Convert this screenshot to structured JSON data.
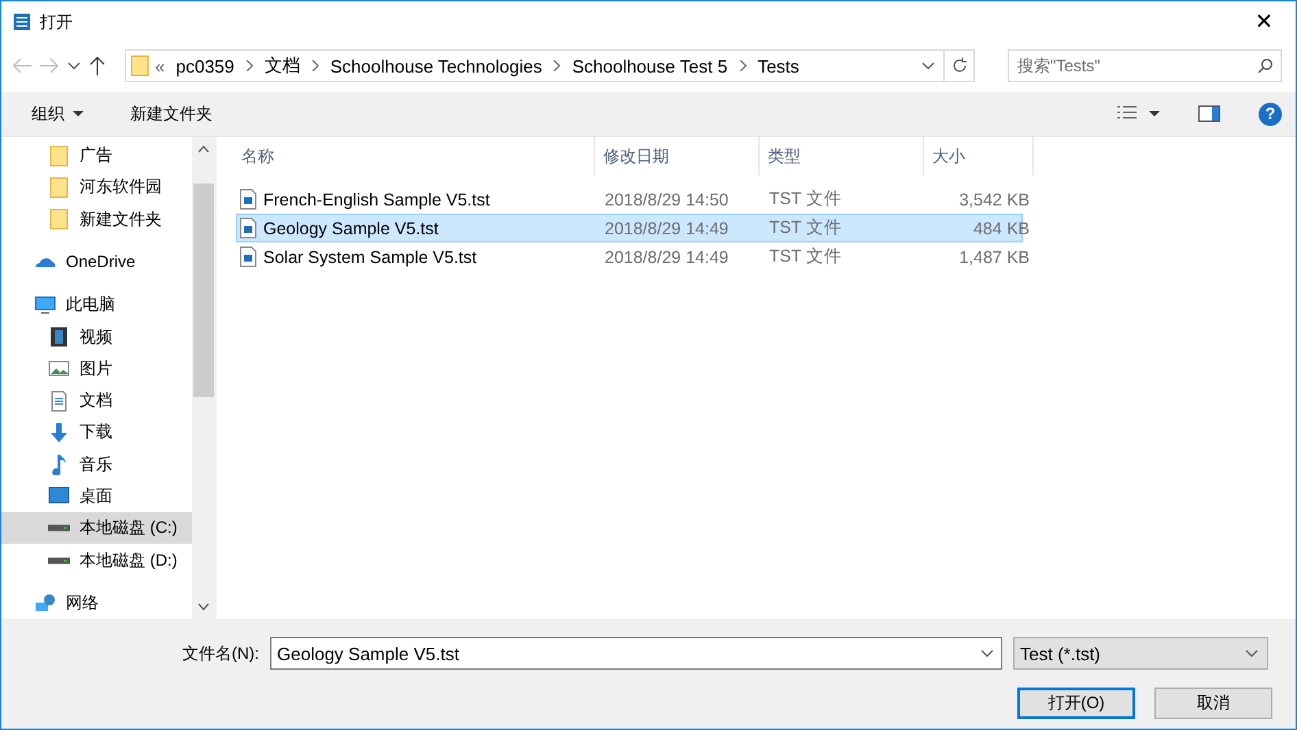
{
  "window": {
    "title": "打开",
    "close": "✕"
  },
  "address": {
    "overflow": "«",
    "crumbs": [
      "pc0359",
      "文档",
      "Schoolhouse Technologies",
      "Schoolhouse Test 5",
      "Tests"
    ]
  },
  "search": {
    "placeholder": "搜索\"Tests\""
  },
  "toolbar": {
    "organize": "组织",
    "new_folder": "新建文件夹",
    "help": "?"
  },
  "sidebar": {
    "items": [
      {
        "kind": "folder",
        "label": "广告",
        "selected": false
      },
      {
        "kind": "folder",
        "label": "河东软件园",
        "selected": false
      },
      {
        "kind": "folder",
        "label": "新建文件夹",
        "selected": false
      },
      {
        "kind": "cloud",
        "label": "OneDrive",
        "selected": false
      },
      {
        "kind": "computer",
        "label": "此电脑",
        "selected": false,
        "children": [
          {
            "kind": "video",
            "label": "视频",
            "selected": false
          },
          {
            "kind": "pictures",
            "label": "图片",
            "selected": false
          },
          {
            "kind": "documents",
            "label": "文档",
            "selected": false
          },
          {
            "kind": "downloads",
            "label": "下载",
            "selected": false
          },
          {
            "kind": "music",
            "label": "音乐",
            "selected": false
          },
          {
            "kind": "desktop",
            "label": "桌面",
            "selected": false
          },
          {
            "kind": "drive",
            "label": "本地磁盘 (C:)",
            "selected": true
          },
          {
            "kind": "drive",
            "label": "本地磁盘 (D:)",
            "selected": false
          }
        ]
      },
      {
        "kind": "network",
        "label": "网络",
        "selected": false
      }
    ]
  },
  "table": {
    "columns": [
      "名称",
      "修改日期",
      "类型",
      "大小"
    ],
    "rows": [
      {
        "name": "French-English Sample V5.tst",
        "modified": "2018/8/29 14:50",
        "type": "TST 文件",
        "size": "3,542 KB",
        "selected": false
      },
      {
        "name": "Geology Sample V5.tst",
        "modified": "2018/8/29 14:49",
        "type": "TST 文件",
        "size": "484 KB",
        "selected": true
      },
      {
        "name": "Solar System Sample V5.tst",
        "modified": "2018/8/29 14:49",
        "type": "TST 文件",
        "size": "1,487 KB",
        "selected": false
      }
    ]
  },
  "footer": {
    "filename_label": "文件名(N):",
    "filename": "Geology Sample V5.tst",
    "filter": "Test (*.tst)",
    "open": "打开(O)",
    "cancel": "取消"
  }
}
